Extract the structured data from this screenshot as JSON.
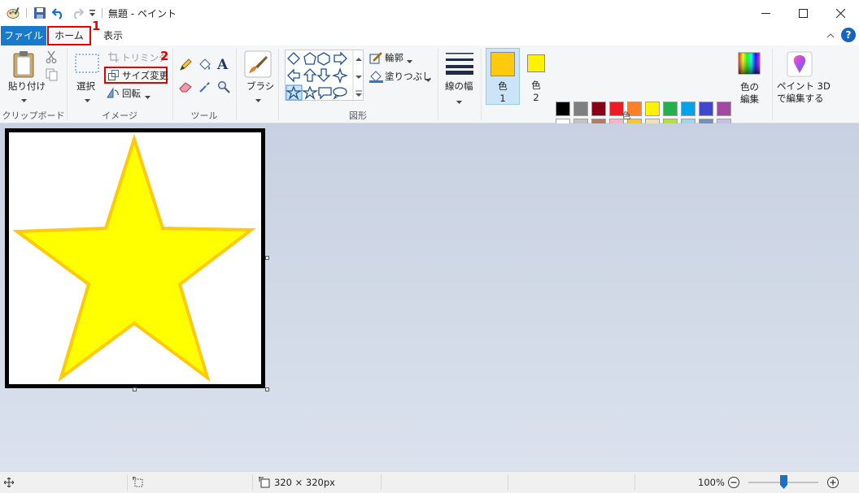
{
  "window": {
    "title": "無題 - ペイント",
    "minimize_label": "—",
    "maximize_label": "☐",
    "close_label": "✕"
  },
  "tabs": [
    {
      "label": "ファイル"
    },
    {
      "label": "ホーム"
    },
    {
      "label": "表示"
    }
  ],
  "annotations": {
    "mark1": "1",
    "mark2": "2"
  },
  "ribbon": {
    "clipboard": {
      "paste_label": "貼り付け",
      "group_label": "クリップボード"
    },
    "image": {
      "select_label": "選択",
      "crop_label": "トリミング",
      "resize_label": "サイズ変更",
      "rotate_label": "回転",
      "group_label": "イメージ"
    },
    "tools": {
      "group_label": "ツール"
    },
    "brushes": {
      "label": "ブラシ"
    },
    "shapes": {
      "outline_label": "輪郭",
      "fill_label": "塗りつぶし",
      "group_label": "図形"
    },
    "size": {
      "label": "線の幅"
    },
    "colors": {
      "color1_label": "色",
      "color1_sub": "1",
      "color2_label": "色",
      "color2_sub": "2",
      "edit_label_1": "色の",
      "edit_label_2": "編集",
      "group_label": "色",
      "color1_value": "#ffc90e",
      "color2_value": "#fff200",
      "palette_row1": [
        "#000000",
        "#7f7f7f",
        "#880015",
        "#ed1c24",
        "#ff7f27",
        "#fff200",
        "#22b14c",
        "#00a2e8",
        "#3f48cc",
        "#a349a4"
      ],
      "palette_row2": [
        "#ffffff",
        "#c3c3c3",
        "#b97a57",
        "#ffaec9",
        "#ffc90e",
        "#efe4b0",
        "#b5e61d",
        "#99d9ea",
        "#7092be",
        "#c8bfe7"
      ],
      "palette_row3": [
        "#ffff00",
        "#ffffff",
        "#ffffff",
        "#ffffff",
        "#ffffff",
        "#ffffff",
        "#ffffff",
        "#ffffff",
        "#ffffff",
        "#ffffff"
      ]
    },
    "paint3d": {
      "label_1": "ペイント 3D",
      "label_2": "で編集する"
    }
  },
  "canvas": {
    "star_fill": "#ffff00",
    "star_stroke": "#ffc90e"
  },
  "status": {
    "image_size": "320 × 320px",
    "zoom": "100%",
    "zoom_fraction": 0.5
  }
}
